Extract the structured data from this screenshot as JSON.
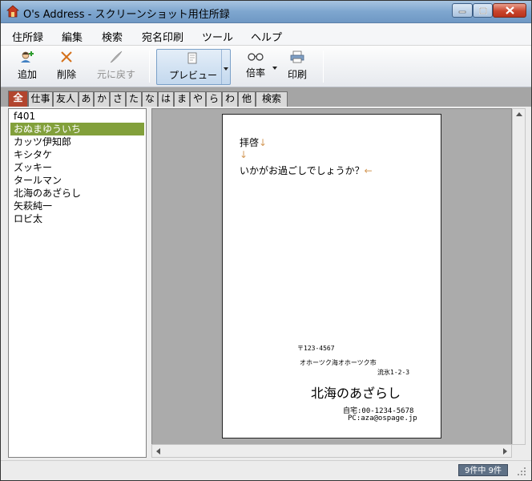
{
  "window": {
    "title": "O's Address - スクリーンショット用住所録"
  },
  "menu": [
    "住所録",
    "編集",
    "検索",
    "宛名印刷",
    "ツール",
    "ヘルプ"
  ],
  "toolbar": {
    "add": "追加",
    "delete": "削除",
    "undo": "元に戻す",
    "preview": "プレビュー",
    "zoom": "倍率",
    "print": "印刷"
  },
  "tabs": [
    "全",
    "仕事",
    "友人",
    "あ",
    "か",
    "さ",
    "た",
    "な",
    "は",
    "ま",
    "や",
    "ら",
    "わ",
    "他",
    "検索"
  ],
  "contacts": [
    "f401",
    "おぬまゆういち",
    "カッツ伊知郎",
    "キシタケ",
    "ズッキー",
    "タールマン",
    "北海のあざらし",
    "矢萩純一",
    "ロビ太"
  ],
  "preview": {
    "greeting": "拝啓",
    "body": "いかがお過ごしでしょうか？",
    "postal": "〒123-4567",
    "address1": "オホーツク海オホーツク市",
    "address2": "流氷1-2-3",
    "name": "北海のあざらし",
    "phone": "自宅:00-1234-5678",
    "email": "PC:aza@ospage.jp"
  },
  "status": {
    "count": "9件中 9件"
  },
  "colors": {
    "active_tab": "#b2452e",
    "selected_row": "#82a03b",
    "status_badge": "#5f7186"
  }
}
